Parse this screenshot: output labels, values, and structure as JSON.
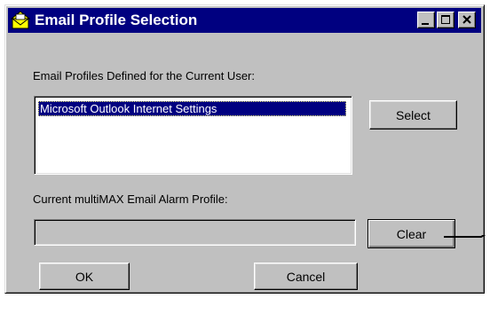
{
  "window": {
    "title": "Email Profile Selection",
    "icon": "envelope-folder-icon",
    "controls": {
      "minimize": "minimize-icon",
      "maximize": "maximize-icon",
      "close": "close-icon"
    }
  },
  "profiles": {
    "label": "Email Profiles Defined for the Current User:",
    "items": [
      {
        "label": "Microsoft Outlook Internet Settings",
        "selected": true
      }
    ]
  },
  "alarm_profile": {
    "label": "Current multiMAX Email Alarm Profile:",
    "value": ""
  },
  "buttons": {
    "select": "Select",
    "clear": "Clear",
    "ok": "OK",
    "cancel": "Cancel"
  },
  "colors": {
    "titlebar": "#000080",
    "face": "#c0c0c0",
    "selection": "#000080"
  }
}
